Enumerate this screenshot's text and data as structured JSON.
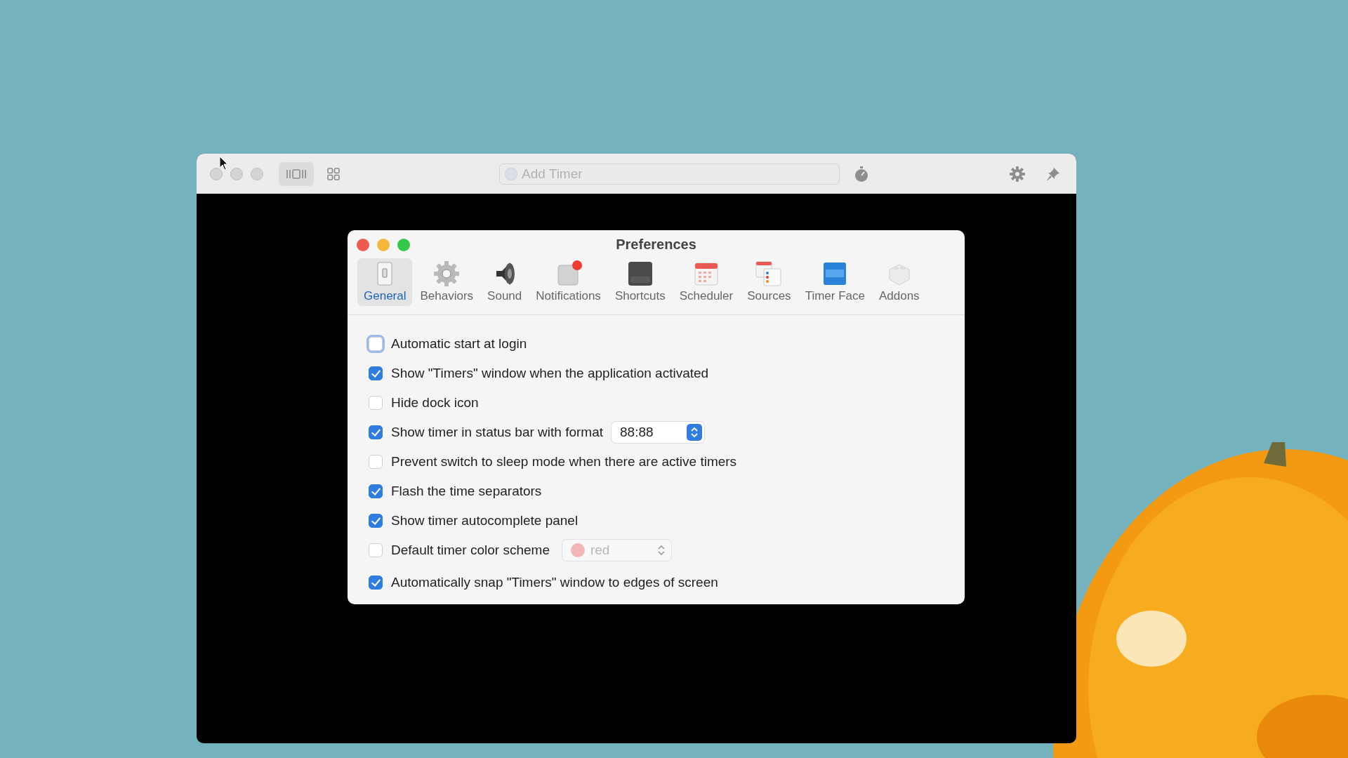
{
  "main_window": {
    "view_buttons": [
      {
        "kind": "columns",
        "selected": true
      },
      {
        "kind": "grid",
        "selected": false
      }
    ],
    "search": {
      "placeholder": "Add Timer"
    }
  },
  "preferences": {
    "title": "Preferences",
    "tabs": [
      {
        "kind": "general",
        "label": "General",
        "selected": true
      },
      {
        "kind": "behaviors",
        "label": "Behaviors",
        "selected": false
      },
      {
        "kind": "sound",
        "label": "Sound",
        "selected": false
      },
      {
        "kind": "notifications",
        "label": "Notifications",
        "selected": false
      },
      {
        "kind": "shortcuts",
        "label": "Shortcuts",
        "selected": false
      },
      {
        "kind": "scheduler",
        "label": "Scheduler",
        "selected": false
      },
      {
        "kind": "sources",
        "label": "Sources",
        "selected": false
      },
      {
        "kind": "timerface",
        "label": "Timer Face",
        "selected": false
      },
      {
        "kind": "addons",
        "label": "Addons",
        "selected": false
      }
    ],
    "options": [
      {
        "label": "Automatic start at login",
        "checked": false,
        "focused": true
      },
      {
        "label": "Show \"Timers\" window when the application activated",
        "checked": true,
        "focused": false
      },
      {
        "label": "Hide dock icon",
        "checked": false,
        "focused": false
      },
      {
        "label": "Show timer in status bar with format",
        "checked": true,
        "focused": false,
        "control": {
          "kind": "stepper",
          "value": "88:88",
          "disabled": false
        }
      },
      {
        "label": "Prevent switch to sleep mode when there are active timers",
        "checked": false,
        "focused": false
      },
      {
        "label": "Flash the time separators",
        "checked": true,
        "focused": false
      },
      {
        "label": "Show timer autocomplete panel",
        "checked": true,
        "focused": false
      },
      {
        "label": "Default timer color scheme",
        "checked": false,
        "focused": false,
        "control": {
          "kind": "color-popup",
          "value": "red",
          "disabled": true
        }
      },
      {
        "label": "Automatically snap \"Timers\" window to edges of screen",
        "checked": true,
        "focused": false
      }
    ]
  }
}
